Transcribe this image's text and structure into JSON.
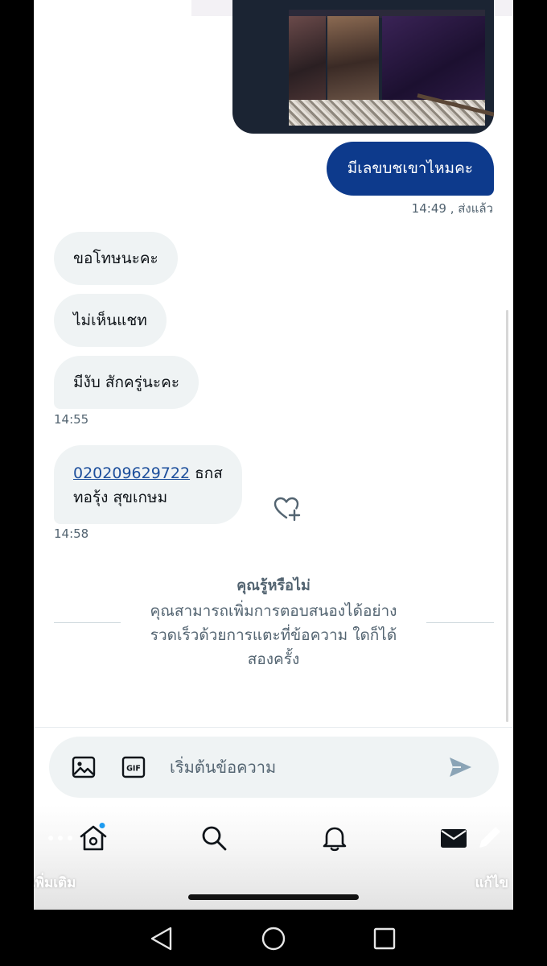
{
  "conversation": {
    "outgoing_message": "มีเลขบชเขาไหมคะ",
    "outgoing_time": "14:49",
    "outgoing_status": ", ส่งแล้ว",
    "incoming_messages": [
      {
        "text": "ขอโทษนะคะ"
      },
      {
        "text": "ไม่เห็นแชท"
      },
      {
        "text": "มีงับ สักครู่นะคะ"
      }
    ],
    "incoming_group1_time": "14:55",
    "account_message": {
      "account_number": "020209629722",
      "bank_suffix": " ธกส",
      "account_name": "ทอรุ้ง สุขเกษม"
    },
    "incoming_group2_time": "14:58"
  },
  "did_you_know": {
    "title": "คุณรู้หรือไม่",
    "body_lines": [
      "คุณสามารถเพิ่มการตอบสนองได้อย่าง",
      "รวดเร็วด้วยการแตะที่ข้อความ ใดก็ได้",
      "สองครั้ง"
    ]
  },
  "composer": {
    "placeholder": "เริ่มต้นข้อความ"
  },
  "bottom_nav": {
    "more_label": "เพิ่มเติม",
    "edit_label": "แก้ไข",
    "icons": [
      "home-icon",
      "search-icon",
      "bell-icon",
      "mail-icon"
    ]
  },
  "colors": {
    "outgoing_bubble": "#0d3a8c",
    "incoming_bubble": "#eff3f4",
    "link": "#1d4f9c",
    "notification_dot": "#1d9bf0"
  }
}
